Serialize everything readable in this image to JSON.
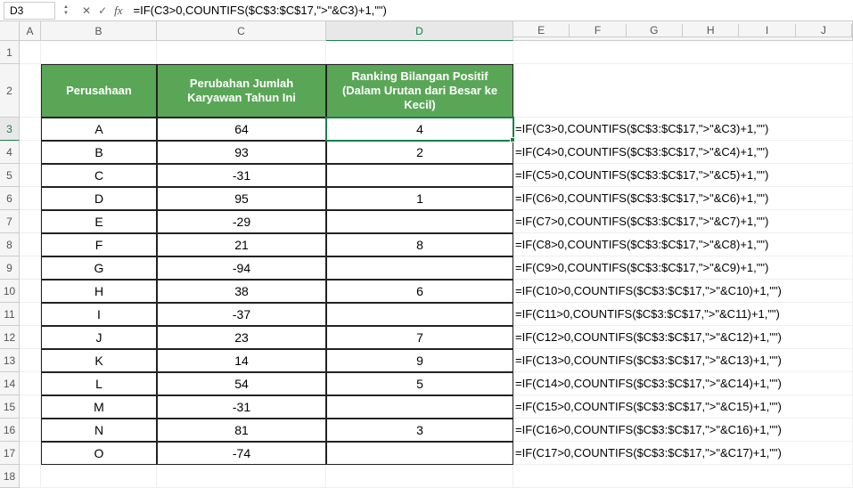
{
  "namebox": {
    "value": "D3"
  },
  "formula_bar": {
    "value": "=IF(C3>0,COUNTIFS($C$3:$C$17,\">\"&C3)+1,\"\")"
  },
  "col_letters": [
    "A",
    "B",
    "C",
    "D",
    "E",
    "F",
    "G",
    "H",
    "I",
    "J"
  ],
  "sub_col_letters": [
    "E",
    "F",
    "G",
    "H",
    "I",
    "J"
  ],
  "row_numbers": [
    "1",
    "2",
    "3",
    "4",
    "5",
    "6",
    "7",
    "8",
    "9",
    "10",
    "11",
    "12",
    "13",
    "14",
    "15",
    "16",
    "17",
    "18"
  ],
  "headers": {
    "company": "Perusahaan",
    "change": "Perubahan Jumlah Karyawan Tahun Ini",
    "rank": "Ranking Bilangan Positif (Dalam Urutan dari Besar ke Kecil)"
  },
  "rows": [
    {
      "company": "A",
      "change": "64",
      "rank": "4",
      "formula": "=IF(C3>0,COUNTIFS($C$3:$C$17,\">\"&C3)+1,\"\")"
    },
    {
      "company": "B",
      "change": "93",
      "rank": "2",
      "formula": "=IF(C4>0,COUNTIFS($C$3:$C$17,\">\"&C4)+1,\"\")"
    },
    {
      "company": "C",
      "change": "-31",
      "rank": "",
      "formula": "=IF(C5>0,COUNTIFS($C$3:$C$17,\">\"&C5)+1,\"\")"
    },
    {
      "company": "D",
      "change": "95",
      "rank": "1",
      "formula": "=IF(C6>0,COUNTIFS($C$3:$C$17,\">\"&C6)+1,\"\")"
    },
    {
      "company": "E",
      "change": "-29",
      "rank": "",
      "formula": "=IF(C7>0,COUNTIFS($C$3:$C$17,\">\"&C7)+1,\"\")"
    },
    {
      "company": "F",
      "change": "21",
      "rank": "8",
      "formula": "=IF(C8>0,COUNTIFS($C$3:$C$17,\">\"&C8)+1,\"\")"
    },
    {
      "company": "G",
      "change": "-94",
      "rank": "",
      "formula": "=IF(C9>0,COUNTIFS($C$3:$C$17,\">\"&C9)+1,\"\")"
    },
    {
      "company": "H",
      "change": "38",
      "rank": "6",
      "formula": "=IF(C10>0,COUNTIFS($C$3:$C$17,\">\"&C10)+1,\"\")"
    },
    {
      "company": "I",
      "change": "-37",
      "rank": "",
      "formula": "=IF(C11>0,COUNTIFS($C$3:$C$17,\">\"&C11)+1,\"\")"
    },
    {
      "company": "J",
      "change": "23",
      "rank": "7",
      "formula": "=IF(C12>0,COUNTIFS($C$3:$C$17,\">\"&C12)+1,\"\")"
    },
    {
      "company": "K",
      "change": "14",
      "rank": "9",
      "formula": "=IF(C13>0,COUNTIFS($C$3:$C$17,\">\"&C13)+1,\"\")"
    },
    {
      "company": "L",
      "change": "54",
      "rank": "5",
      "formula": "=IF(C14>0,COUNTIFS($C$3:$C$17,\">\"&C14)+1,\"\")"
    },
    {
      "company": "M",
      "change": "-31",
      "rank": "",
      "formula": "=IF(C15>0,COUNTIFS($C$3:$C$17,\">\"&C15)+1,\"\")"
    },
    {
      "company": "N",
      "change": "81",
      "rank": "3",
      "formula": "=IF(C16>0,COUNTIFS($C$3:$C$17,\">\"&C16)+1,\"\")"
    },
    {
      "company": "O",
      "change": "-74",
      "rank": "",
      "formula": "=IF(C17>0,COUNTIFS($C$3:$C$17,\">\"&C17)+1,\"\")"
    }
  ],
  "chart_data": {
    "type": "table",
    "title": "Ranking Bilangan Positif dari Perubahan Jumlah Karyawan",
    "columns": [
      "Perusahaan",
      "Perubahan Jumlah Karyawan Tahun Ini",
      "Ranking Bilangan Positif (Dalam Urutan dari Besar ke Kecil)"
    ],
    "data": [
      [
        "A",
        64,
        4
      ],
      [
        "B",
        93,
        2
      ],
      [
        "C",
        -31,
        null
      ],
      [
        "D",
        95,
        1
      ],
      [
        "E",
        -29,
        null
      ],
      [
        "F",
        21,
        8
      ],
      [
        "G",
        -94,
        null
      ],
      [
        "H",
        38,
        6
      ],
      [
        "I",
        -37,
        null
      ],
      [
        "J",
        23,
        7
      ],
      [
        "K",
        14,
        9
      ],
      [
        "L",
        54,
        5
      ],
      [
        "M",
        -31,
        null
      ],
      [
        "N",
        81,
        3
      ],
      [
        "O",
        -74,
        null
      ]
    ]
  }
}
